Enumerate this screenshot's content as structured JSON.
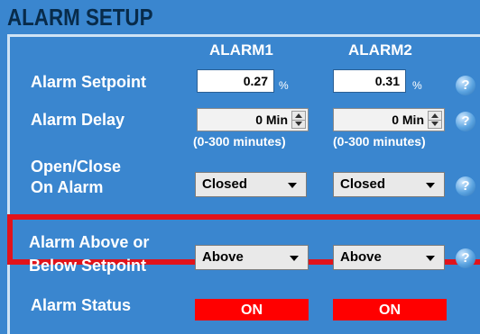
{
  "title": "ALARM SETUP",
  "columns": {
    "alarm1": "ALARM1",
    "alarm2": "ALARM2"
  },
  "rows": {
    "setpoint": {
      "label": "Alarm Setpoint",
      "alarm1_value": "0.27",
      "alarm2_value": "0.31",
      "unit": "%"
    },
    "delay": {
      "label": "Alarm Delay",
      "alarm1_value": "0 Min",
      "alarm2_value": "0 Min",
      "range_hint": "(0-300 minutes)"
    },
    "open_close": {
      "label_line1": "Open/Close",
      "label_line2": "On Alarm",
      "alarm1_value": "Closed",
      "alarm2_value": "Closed"
    },
    "above_below": {
      "label_line1": "Alarm Above or",
      "label_line2": "Below Setpoint",
      "alarm1_value": "Above",
      "alarm2_value": "Above"
    },
    "status": {
      "label": "Alarm Status",
      "alarm1_value": "ON",
      "alarm2_value": "ON"
    }
  },
  "help_glyph": "?",
  "colors": {
    "background": "#3a86cf",
    "title": "#082b4a",
    "highlight": "#e1131b",
    "status_on": "#ff0000"
  }
}
